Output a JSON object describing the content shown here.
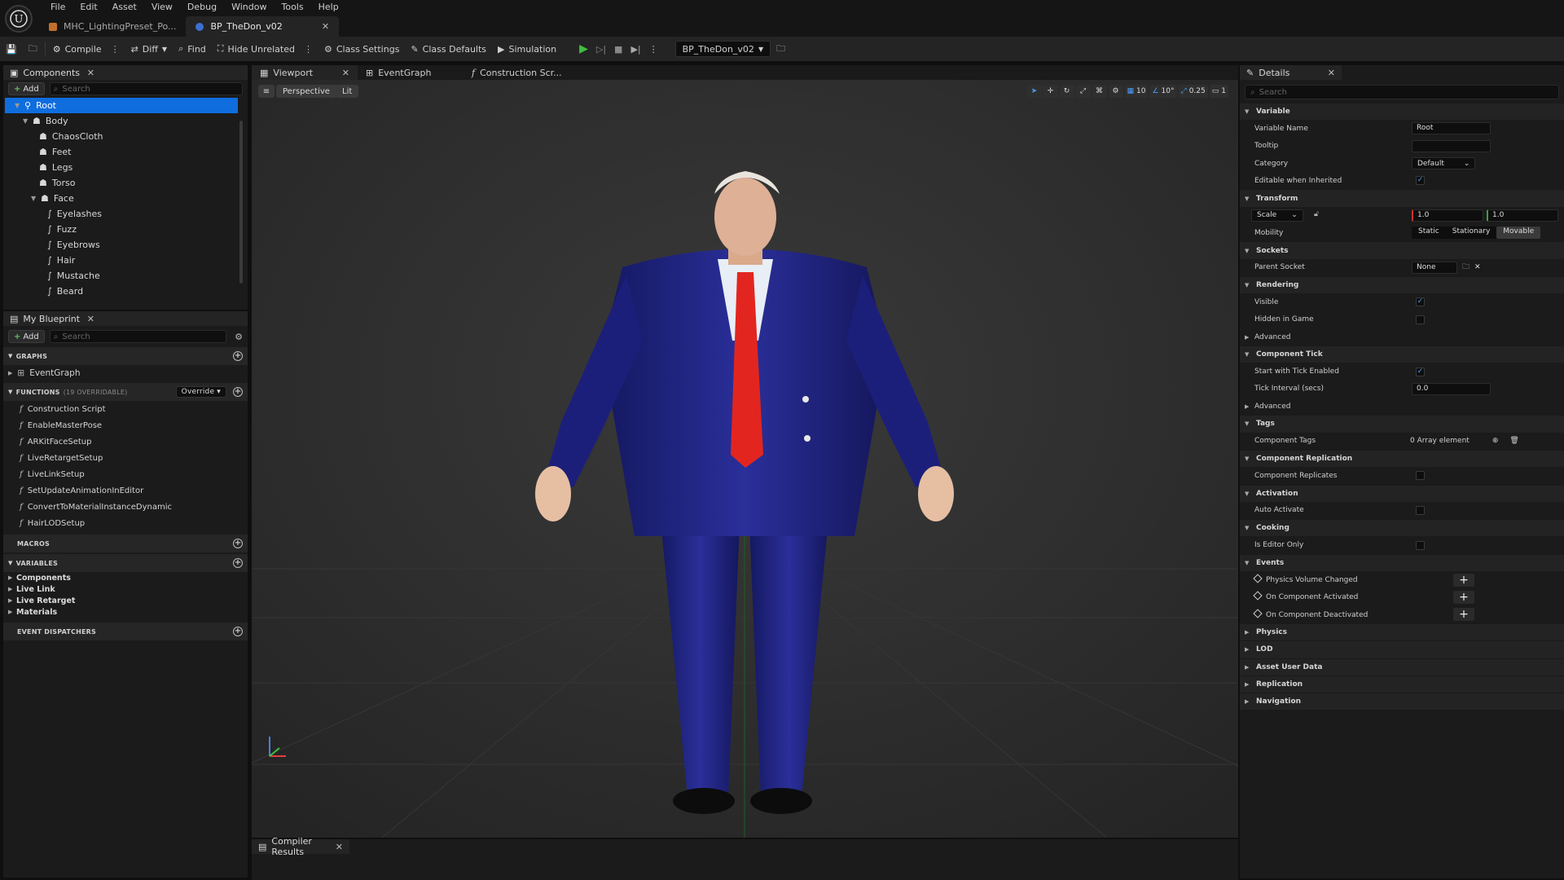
{
  "menu": [
    "File",
    "Edit",
    "Asset",
    "View",
    "Debug",
    "Window",
    "Tools",
    "Help"
  ],
  "doc_tabs": [
    {
      "label": "MHC_LightingPreset_Po..."
    },
    {
      "label": "BP_TheDon_v02"
    }
  ],
  "toolbar": {
    "compile": "Compile",
    "diff": "Diff",
    "find": "Find",
    "hide_unrelated": "Hide Unrelated",
    "class_settings": "Class Settings",
    "class_defaults": "Class Defaults",
    "simulation": "Simulation",
    "debug_object": "BP_TheDon_v02"
  },
  "components": {
    "tab": "Components",
    "add": "Add",
    "search_placeholder": "Search",
    "tree": [
      "Root",
      "Body",
      "ChaosCloth",
      "Feet",
      "Legs",
      "Torso",
      "Face",
      "Eyelashes",
      "Fuzz",
      "Eyebrows",
      "Hair",
      "Mustache",
      "Beard"
    ]
  },
  "my_blueprint": {
    "tab": "My Blueprint",
    "add": "Add",
    "search_placeholder": "Search",
    "graphs_label": "GRAPHS",
    "event_graph": "EventGraph",
    "functions_label": "FUNCTIONS",
    "functions_count": "(19 OVERRIDABLE)",
    "override": "Override",
    "functions": [
      "Construction Script",
      "EnableMasterPose",
      "ARKitFaceSetup",
      "LiveRetargetSetup",
      "LiveLinkSetup",
      "SetUpdateAnimationInEditor",
      "ConvertToMaterialInstanceDynamic",
      "HairLODSetup"
    ],
    "macros_label": "MACROS",
    "variables_label": "VARIABLES",
    "variables": [
      "Components",
      "Live Link",
      "Live Retarget",
      "Materials"
    ],
    "dispatchers_label": "EVENT DISPATCHERS"
  },
  "viewport": {
    "tabs": [
      "Viewport",
      "EventGraph",
      "Construction Scr..."
    ],
    "perspective": "Perspective",
    "lit": "Lit",
    "grid_snap": "10",
    "rot_snap": "10°",
    "scale_snap": "0.25",
    "camera_speed": "1"
  },
  "compiler_results": "Compiler Results",
  "details": {
    "tab": "Details",
    "search_placeholder": "Search",
    "variable": {
      "label": "Variable",
      "variable_name_label": "Variable Name",
      "variable_name": "Root",
      "tooltip_label": "Tooltip",
      "tooltip": "",
      "category_label": "Category",
      "category": "Default",
      "editable_label": "Editable when Inherited"
    },
    "transform": {
      "label": "Transform",
      "scale_label": "Scale",
      "scale_x": "1.0",
      "scale_y": "1.0",
      "mobility_label": "Mobility",
      "mobility": [
        "Static",
        "Stationary",
        "Movable"
      ]
    },
    "sockets": {
      "label": "Sockets",
      "parent_socket_label": "Parent Socket",
      "parent_socket": "None"
    },
    "rendering": {
      "label": "Rendering",
      "visible_label": "Visible",
      "hidden_label": "Hidden in Game",
      "advanced_label": "Advanced"
    },
    "component_tick": {
      "label": "Component Tick",
      "start_label": "Start with Tick Enabled",
      "interval_label": "Tick Interval (secs)",
      "interval": "0.0",
      "advanced_label": "Advanced"
    },
    "tags": {
      "label": "Tags",
      "component_tags_label": "Component Tags",
      "component_tags": "0 Array element"
    },
    "replication": {
      "label": "Component Replication",
      "replicates_label": "Component Replicates"
    },
    "activation": {
      "label": "Activation",
      "auto_activate_label": "Auto Activate"
    },
    "cooking": {
      "label": "Cooking",
      "editor_only_label": "Is Editor Only"
    },
    "events": {
      "label": "Events",
      "items": [
        "Physics Volume Changed",
        "On Component Activated",
        "On Component Deactivated"
      ]
    },
    "collapsed": [
      "Physics",
      "LOD",
      "Asset User Data",
      "Replication",
      "Navigation"
    ]
  },
  "colors": {
    "selection": "#0f6dde",
    "suit": "#1c1f7a",
    "tie": "#e2261f",
    "play": "#3fbf3f"
  }
}
